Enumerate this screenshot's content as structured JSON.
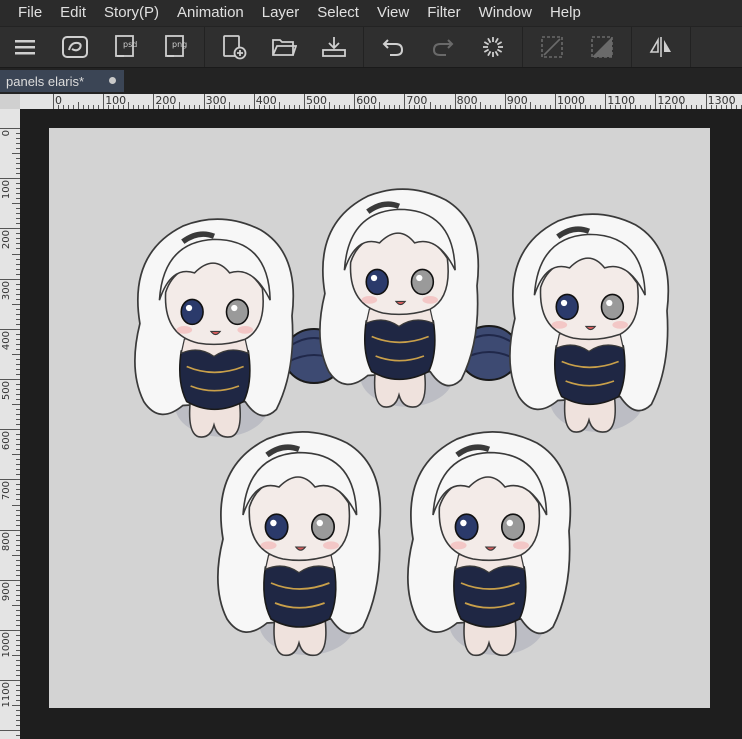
{
  "menu": {
    "items": [
      "File",
      "Edit",
      "Story(P)",
      "Animation",
      "Layer",
      "Select",
      "View",
      "Filter",
      "Window",
      "Help"
    ]
  },
  "toolbar": {
    "icons": [
      "menu-icon",
      "clip-studio-icon",
      "export-psd-icon",
      "export-png-icon",
      "new-file-icon",
      "open-folder-icon",
      "save-icon",
      "undo-icon",
      "redo-icon",
      "loading-spinner-icon",
      "clear-selection-icon",
      "invert-selection-icon",
      "flip-horizontal-icon"
    ],
    "labels": {
      "psd": "psd",
      "png": "png"
    }
  },
  "tab": {
    "title": "panels elaris*"
  },
  "ruler": {
    "horizontal_labels": [
      "0",
      "100",
      "200",
      "300",
      "400",
      "500",
      "600",
      "700",
      "800",
      "900",
      "1000",
      "1100",
      "1200",
      "1300"
    ],
    "vertical_labels": [
      "0",
      "100",
      "200",
      "300",
      "400",
      "500",
      "600",
      "700",
      "800",
      "900",
      "1000",
      "1100"
    ]
  },
  "colors": {
    "canvas_bg": "#d3d3d3",
    "workspace_bg": "#1e1e1e",
    "tab_active": "#3b4555",
    "outfit_navy": "#1f2744",
    "accent_gold": "#c9a04a",
    "hair_white": "#f7f7f7"
  },
  "canvas": {
    "content": "chibi-characters-illustration"
  }
}
